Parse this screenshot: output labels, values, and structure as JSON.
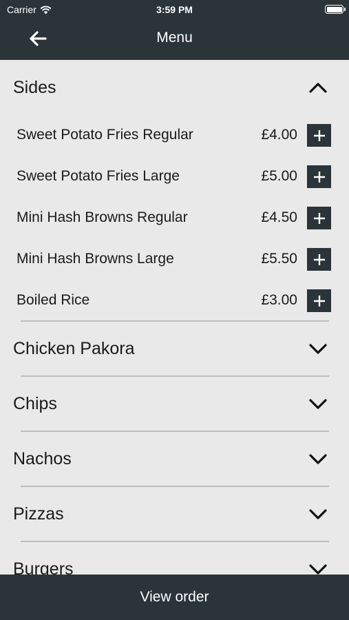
{
  "status_bar": {
    "carrier": "Carrier",
    "time": "3:59 PM"
  },
  "header": {
    "title": "Menu"
  },
  "colors": {
    "header_bg": "#2a3439",
    "page_bg": "#e9e9e9",
    "button_bg": "#2a3439"
  },
  "open_section": {
    "title": "Sides",
    "items": [
      {
        "name": "Sweet Potato Fries Regular",
        "price": "£4.00"
      },
      {
        "name": "Sweet Potato Fries Large",
        "price": "£5.00"
      },
      {
        "name": "Mini Hash Browns Regular",
        "price": "£4.50"
      },
      {
        "name": "Mini Hash Browns Large",
        "price": "£5.50"
      },
      {
        "name": "Boiled Rice",
        "price": "£3.00"
      }
    ]
  },
  "collapsed_sections": [
    "Chicken Pakora",
    "Chips",
    "Nachos",
    "Pizzas",
    "Burgers"
  ],
  "footer": {
    "label": "View order"
  },
  "icons": {
    "back": "arrow-left-icon",
    "expand": "chevron-down-icon",
    "collapse": "chevron-up-icon",
    "add": "plus-icon"
  }
}
